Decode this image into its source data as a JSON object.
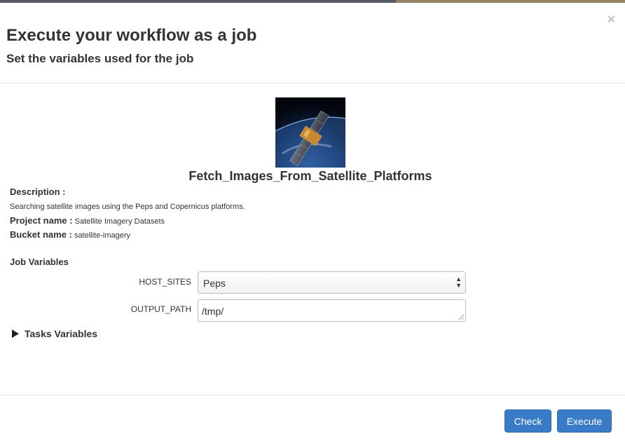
{
  "modal": {
    "close_glyph": "×",
    "title": "Execute your workflow as a job",
    "subtitle": "Set the variables used for the job"
  },
  "workflow": {
    "thumbnail_icon": "satellite-image",
    "name": "Fetch_Images_From_Satellite_Platforms",
    "description_label": "Description :",
    "description": "Searching satellite images using the Peps and Copernicus platforms.",
    "project_label": "Project name :",
    "project_name": "Satellite Imagery Datasets",
    "bucket_label": "Bucket name :",
    "bucket_name": "satellite-imagery"
  },
  "job_variables": {
    "title": "Job Variables",
    "host_sites": {
      "label": "HOST_SITES",
      "value": "Peps"
    },
    "output_path": {
      "label": "OUTPUT_PATH",
      "value": "/tmp/"
    }
  },
  "tasks_variables": {
    "label": "Tasks Variables",
    "expanded": false
  },
  "footer": {
    "check_label": "Check",
    "execute_label": "Execute",
    "button_color": "#3a7bc8"
  }
}
